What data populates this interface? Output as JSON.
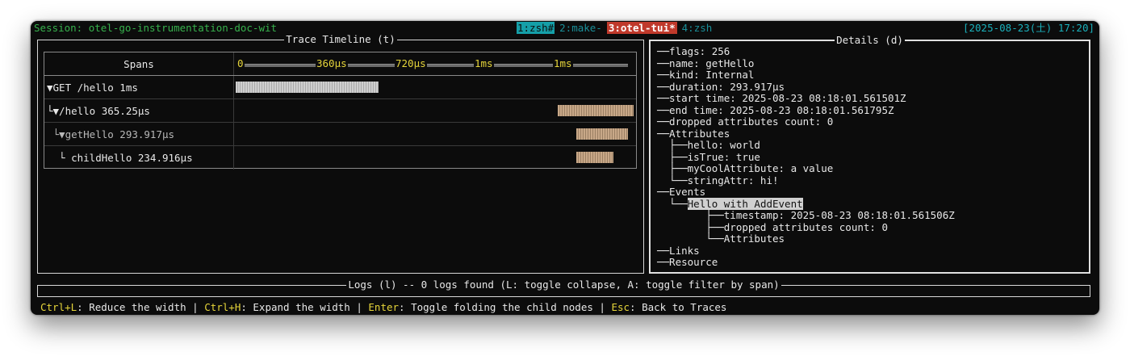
{
  "status_bar": {
    "session": "Session: otel-go-instrumentation-doc-wit",
    "tabs": [
      "1:zsh#",
      "2:make-",
      "3:otel-tui*",
      "4:zsh"
    ],
    "clock": "[2025-08-23(土) 17:20]"
  },
  "timeline": {
    "title": "Trace Timeline (t)",
    "spans_header": "Spans",
    "ticks": [
      "0",
      "360µs",
      "720µs",
      "1ms",
      "1ms"
    ],
    "rows": [
      {
        "label": "▼GET /hello 1ms",
        "start": 0.0,
        "end": 0.36
      },
      {
        "label": "└▼/hello 365.25µs",
        "start": 0.81,
        "end": 1.0
      },
      {
        "label": " └▼getHello 293.917µs",
        "start": 0.855,
        "end": 0.985
      },
      {
        "label": "  └ childHello 234.916µs",
        "start": 0.855,
        "end": 0.95
      }
    ]
  },
  "details": {
    "title": "Details (d)",
    "lines": [
      "──flags: 256",
      "──name: getHello",
      "──kind: Internal",
      "──duration: 293.917µs",
      "──start time: 2025-08-23 08:18:01.561501Z",
      "──end time: 2025-08-23 08:18:01.561795Z",
      "──dropped attributes count: 0",
      "──Attributes",
      "  ├──hello: world",
      "  ├──isTrue: true",
      "  ├──myCoolAttribute: a value",
      "  └──stringAttr: hi!",
      "──Events",
      "  └──",
      "        ├──timestamp: 2025-08-23 08:18:01.561506Z",
      "        ├──dropped attributes count: 0",
      "        └──Attributes",
      "──Links",
      "──Resource"
    ],
    "selected_event": "Hello with AddEvent"
  },
  "logs": {
    "title": "Logs (l) -- 0 logs found (L: toggle collapse, A: toggle filter by span)"
  },
  "help": [
    {
      "key": "Ctrl+L",
      "desc": ": Reduce the width"
    },
    {
      "key": "Ctrl+H",
      "desc": ": Expand the width"
    },
    {
      "key": "Enter",
      "desc": ": Toggle folding the child nodes"
    },
    {
      "key": "Esc",
      "desc": ": Back to Traces"
    }
  ],
  "colors": {
    "terminal_bg": "#0c0c0c",
    "session_green": "#37b24d",
    "tab_cyan": "#159fa8",
    "tab_current_red": "#c0392b",
    "key_yellow": "#e6d53a",
    "bar_root": "#c8c8c8",
    "bar_child": "#b89a7c"
  }
}
